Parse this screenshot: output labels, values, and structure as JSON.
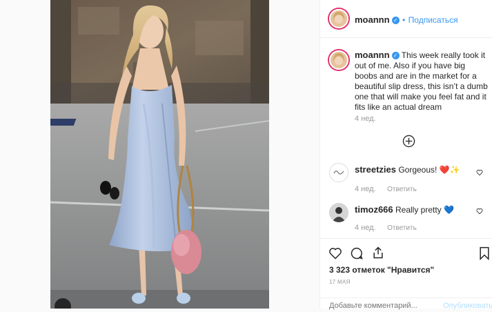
{
  "post": {
    "author": "moannn",
    "follow_separator": "•",
    "follow_label": "Подписаться",
    "caption": "This week really took it out of me. Also if you have big boobs and are in the market for a beautiful slip dress, this isn’t a dumb one that will make you feel fat and it fits like an actual dream",
    "caption_age": "4 нед.",
    "load_more_icon": "plus-circle-icon"
  },
  "comments": [
    {
      "user": "streetzies",
      "text": "Gorgeous! ",
      "emoji": "❤️✨",
      "age": "4 нед.",
      "reply": "Ответить"
    },
    {
      "user": "timoz666",
      "text": "Really pretty ",
      "emoji": "💙",
      "age": "4 нед.",
      "reply": "Ответить"
    }
  ],
  "actions": {
    "icons": [
      "heart-icon",
      "comment-icon",
      "share-icon",
      "bookmark-icon"
    ],
    "likes": "3 323 отметок \"Нравится\"",
    "date": "17 МАЯ"
  },
  "comment_box": {
    "placeholder": "Добавьте комментарий...",
    "publish_label": "Опубликовать"
  },
  "colors": {
    "accent": "#3897f0",
    "dress": "#9fb4d6",
    "publish_disabled": "#b2dffc"
  }
}
